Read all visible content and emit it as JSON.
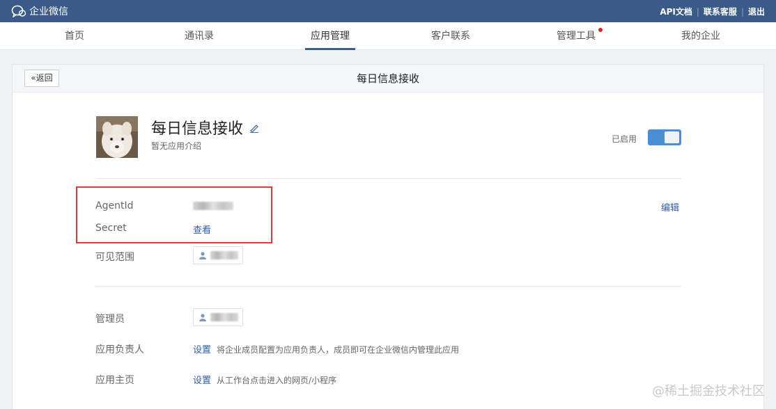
{
  "topbar": {
    "brand": "企业微信",
    "links": [
      "API文档",
      "联系客服",
      "退出"
    ]
  },
  "nav": {
    "items": [
      {
        "label": "首页"
      },
      {
        "label": "通讯录"
      },
      {
        "label": "应用管理",
        "active": true
      },
      {
        "label": "客户联系"
      },
      {
        "label": "管理工具",
        "badge": true
      },
      {
        "label": "我的企业"
      }
    ]
  },
  "page": {
    "back_label": "返回",
    "title": "每日信息接收"
  },
  "app": {
    "name": "每日信息接收",
    "description": "暂无应用介绍",
    "status_label": "已启用",
    "enabled": true
  },
  "credentials": {
    "agentid_label": "AgentId",
    "secret_label": "Secret",
    "secret_action": "查看",
    "edit_label": "编辑"
  },
  "visibility": {
    "label": "可见范围"
  },
  "admin": {
    "label": "管理员"
  },
  "owner": {
    "label": "应用负责人",
    "action": "设置",
    "hint": "将企业成员配置为应用负责人，成员即可在企业微信内管理此应用"
  },
  "homepage": {
    "label": "应用主页",
    "action": "设置",
    "hint": "从工作台点击进入的网页/小程序"
  },
  "watermark": "@稀土掘金技术社区",
  "colors": {
    "topbar": "#3a5a8a",
    "accent_link": "#2d5ca8",
    "toggle_on": "#4a8fd4",
    "highlight_box": "#e0383a"
  }
}
